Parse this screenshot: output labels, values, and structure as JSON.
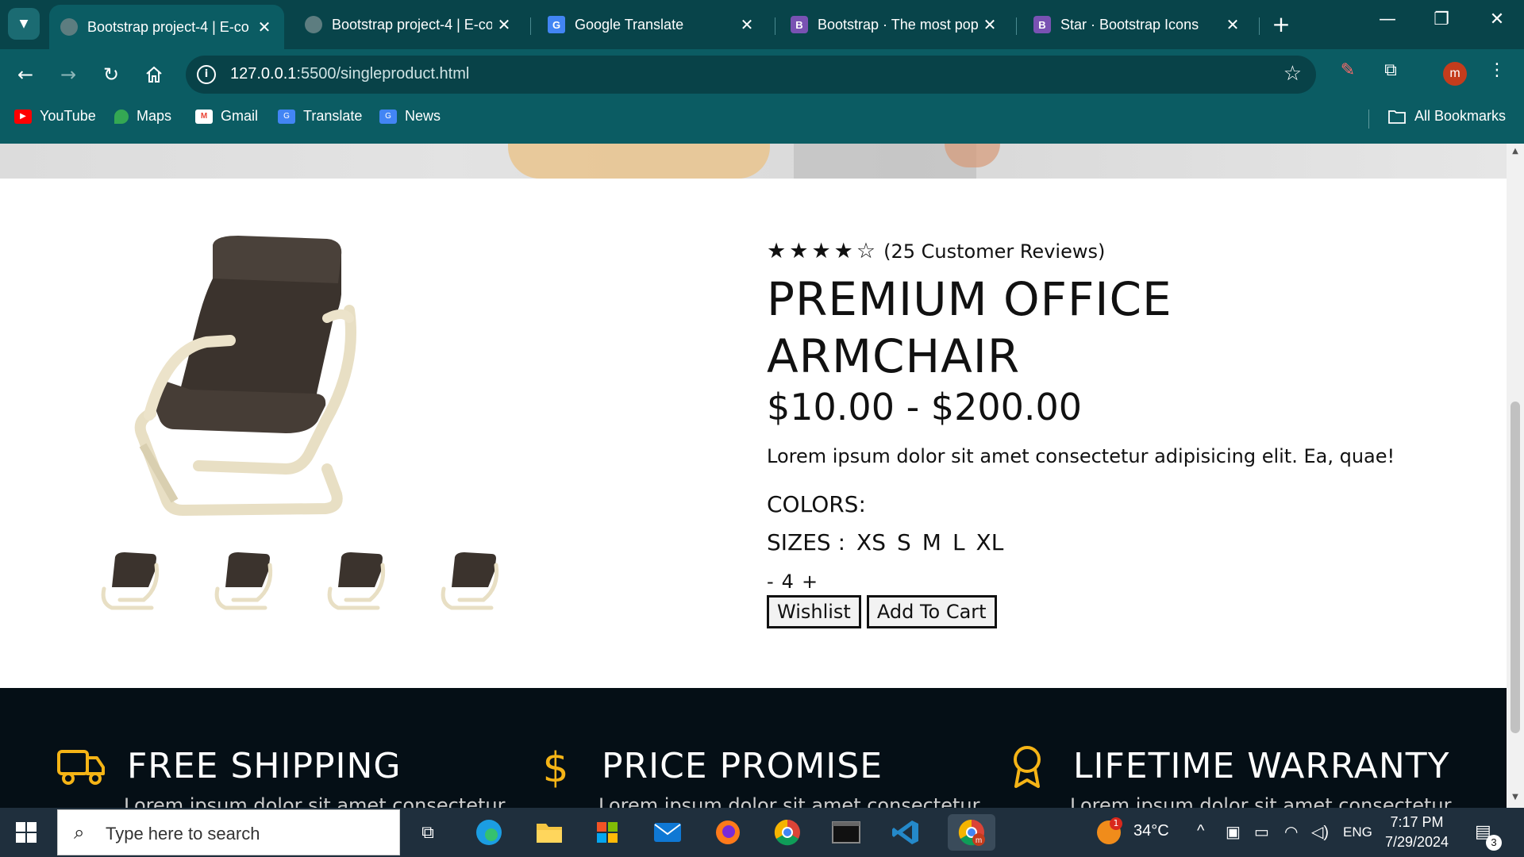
{
  "browser": {
    "tabs": [
      {
        "title": "Bootstrap project-4 | E-co",
        "active": true,
        "favicon": "globe-icon"
      },
      {
        "title": "Bootstrap project-4 | E-co",
        "active": false,
        "favicon": "globe-icon"
      },
      {
        "title": "Google Translate",
        "active": false,
        "favicon": "google-translate-icon"
      },
      {
        "title": "Bootstrap · The most pop",
        "active": false,
        "favicon": "bootstrap-icon"
      },
      {
        "title": "Star · Bootstrap Icons",
        "active": false,
        "favicon": "bootstrap-icon"
      }
    ],
    "url_host": "127.0.0.1",
    "url_rest": ":5500/singleproduct.html",
    "profile_initial": "m",
    "bookmarks": [
      {
        "label": "YouTube",
        "icon": "youtube-icon",
        "color": "#ff0000"
      },
      {
        "label": "Maps",
        "icon": "maps-icon",
        "color": "#34a853"
      },
      {
        "label": "Gmail",
        "icon": "gmail-icon",
        "color": "#ea4335"
      },
      {
        "label": "Translate",
        "icon": "translate-icon",
        "color": "#4285f4"
      },
      {
        "label": "News",
        "icon": "news-icon",
        "color": "#4285f4"
      }
    ],
    "all_bookmarks": "All Bookmarks",
    "colors": {
      "frame": "#08444a",
      "toolbar": "#0b5c63"
    }
  },
  "product": {
    "rating": 4,
    "rating_max": 5,
    "reviews": "(25 Customer Reviews)",
    "title": "PREMIUM OFFICE ARMCHAIR",
    "price": "$10.00 - $200.00",
    "description": "Lorem ipsum dolor sit amet consectetur adipisicing elit. Ea, quae!",
    "colors_label": "COLORS:",
    "sizes_label": "SIZES :",
    "sizes": [
      "XS",
      "S",
      "M",
      "L",
      "XL"
    ],
    "qty_minus": "-",
    "qty_value": "4",
    "qty_plus": "+",
    "wishlist_label": "Wishlist",
    "cart_label": "Add To Cart"
  },
  "features": [
    {
      "title": "FREE SHIPPING",
      "subtitle": "Lorem ipsum dolor sit amet consectetur",
      "icon": "truck-icon"
    },
    {
      "title": "PRICE PROMISE",
      "subtitle": "Lorem ipsum dolor sit amet consectetur",
      "icon": "dollar-icon"
    },
    {
      "title": "LIFETIME WARRANTY",
      "subtitle": "Lorem ipsum dolor sit amet consectetur",
      "icon": "award-icon"
    }
  ],
  "taskbar": {
    "search_placeholder": "Type here to search",
    "temperature": "34°C",
    "weather_badge": "1",
    "language": "ENG",
    "time": "7:17 PM",
    "date": "7/29/2024",
    "notification_count": "3",
    "apps": [
      "task-view-icon",
      "edge-icon",
      "file-explorer-icon",
      "store-icon",
      "mail-icon",
      "firefox-icon",
      "chrome-icon",
      "terminal-icon",
      "vscode-icon",
      "chrome-profile-icon"
    ]
  }
}
